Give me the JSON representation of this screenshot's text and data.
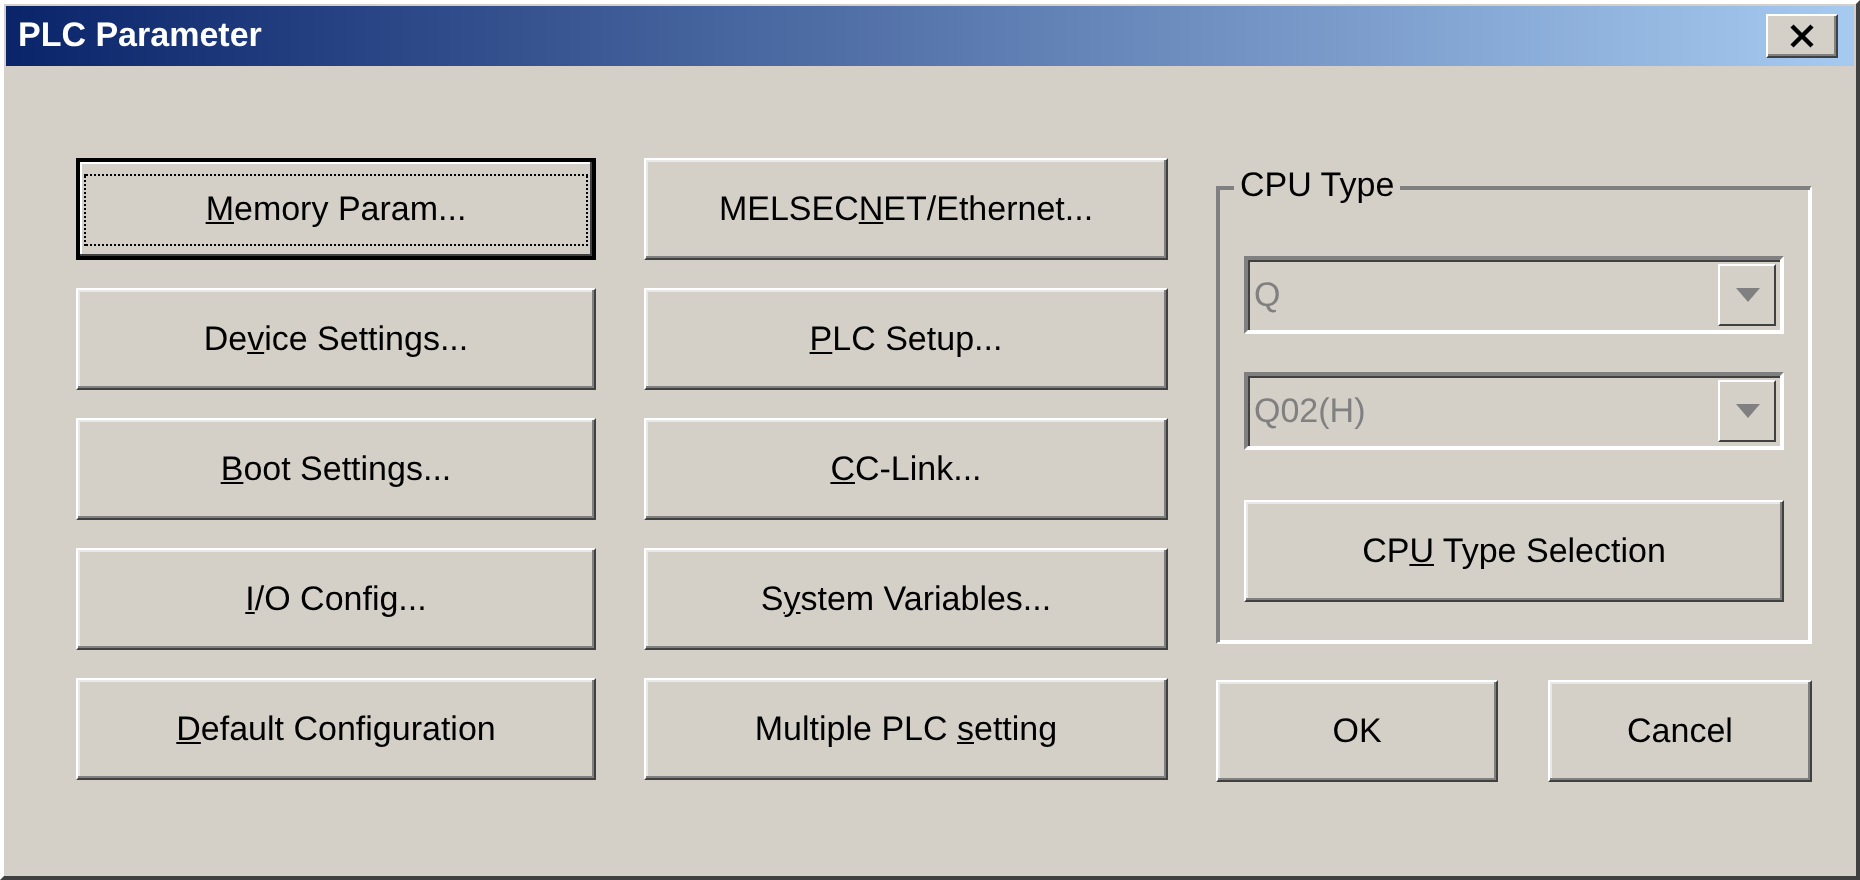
{
  "window": {
    "title": "PLC Parameter"
  },
  "left_buttons": [
    {
      "key": "M",
      "after": "emory Param...",
      "default": true
    },
    {
      "before": "De",
      "key": "v",
      "after": "ice Settings...",
      "default": false
    },
    {
      "key": "B",
      "after": "oot Settings...",
      "default": false
    },
    {
      "key": "I",
      "after": "/O Config...",
      "default": false
    },
    {
      "key": "D",
      "after": "efault Configuration",
      "default": false
    }
  ],
  "middle_buttons": [
    {
      "before": "MELSEC",
      "key": "N",
      "after": "ET/Ethernet...",
      "default": false
    },
    {
      "key": "P",
      "after": "LC Setup...",
      "default": false
    },
    {
      "key": "C",
      "after": "C-Link...",
      "default": false
    },
    {
      "before": "S",
      "key": "y",
      "after": "stem Variables...",
      "default": false
    },
    {
      "before": "Multiple PLC ",
      "key": "s",
      "after": "etting",
      "default": false
    }
  ],
  "cpu_type": {
    "label": "CPU Type",
    "combos": [
      {
        "value": "Q",
        "disabled": true
      },
      {
        "value": "Q02(H)",
        "disabled": true
      }
    ],
    "button": {
      "before": "CP",
      "key": "U",
      "after": " Type Selection",
      "default": false
    }
  },
  "dialog_buttons": [
    {
      "label": "OK",
      "default": false
    },
    {
      "label": "Cancel",
      "default": false
    }
  ]
}
